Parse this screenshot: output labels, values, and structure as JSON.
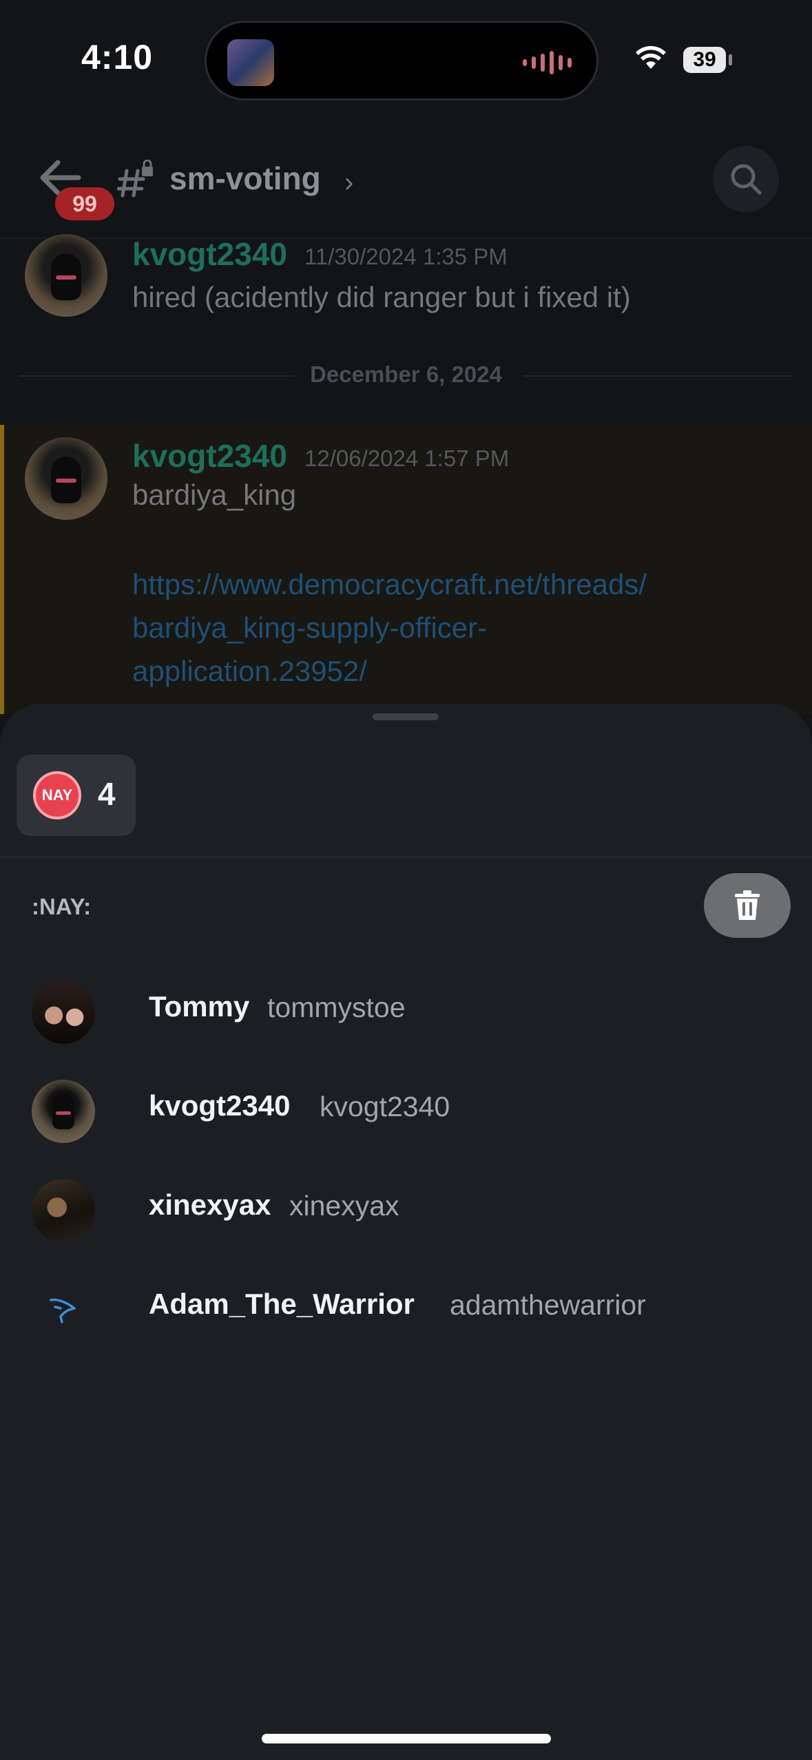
{
  "status_bar": {
    "time": "4:10",
    "battery": "39"
  },
  "header": {
    "channel_name": "sm-voting",
    "mention_count": "99"
  },
  "messages": [
    {
      "author": "kvogt2340",
      "timestamp": "11/30/2024 1:35 PM",
      "text": "hired (acidently did ranger but i fixed it)"
    },
    {
      "author": "kvogt2340",
      "timestamp": "12/06/2024 1:57 PM",
      "text": "bardiya_king",
      "link_lines": [
        "https://www.democracycraft.net/threads/",
        "bardiya_king-supply-officer-",
        "application.23952/"
      ]
    }
  ],
  "date_divider": "December 6, 2024",
  "reaction_sheet": {
    "reaction_label": "NAY",
    "reaction_count": "4",
    "section_label": ":NAY:",
    "users": [
      {
        "display_name": "Tommy",
        "username": "tommystoe"
      },
      {
        "display_name": "kvogt2340",
        "username": "kvogt2340"
      },
      {
        "display_name": "xinexyax",
        "username": "xinexyax"
      },
      {
        "display_name": "Adam_The_Warrior",
        "username": "adamthewarrior"
      }
    ]
  },
  "colors": {
    "accent_nay": "#e8414f",
    "link": "#1d4f78",
    "author": "#1e6e5c",
    "highlight_bar": "#8a6a15"
  }
}
